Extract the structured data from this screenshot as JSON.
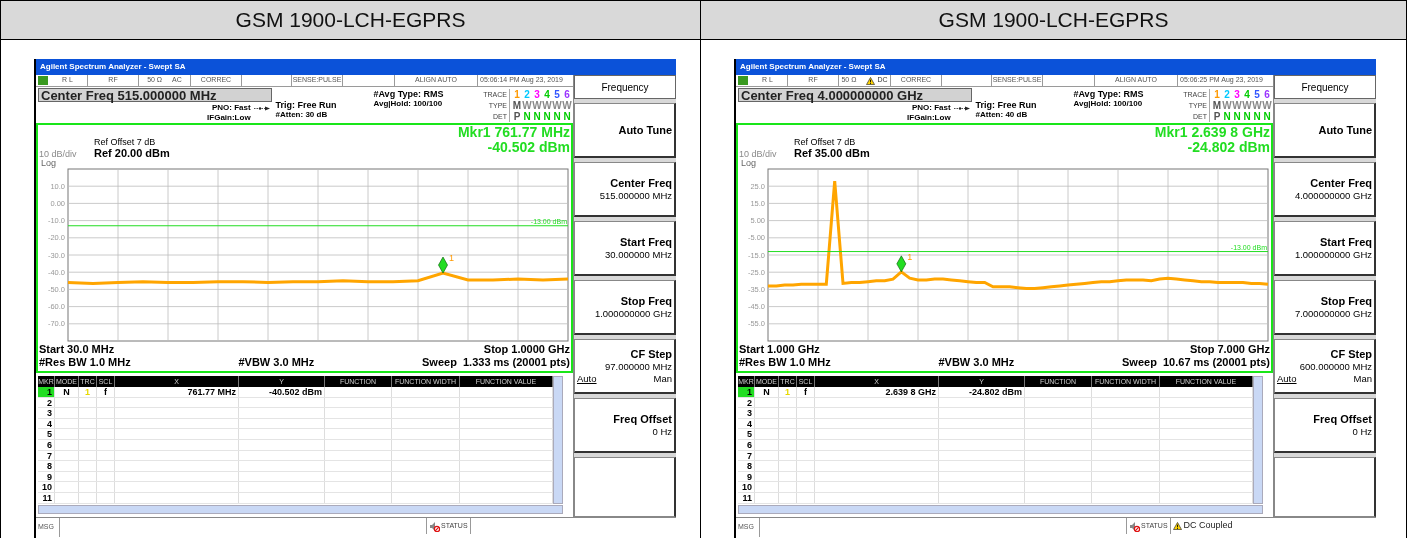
{
  "panels": [
    {
      "heading": "GSM 1900-LCH-EGPRS",
      "window": {
        "title": "Agilent Spectrum Analyzer - Swept SA"
      },
      "status_row": [
        {
          "text": "R L"
        },
        {
          "text": "RF"
        },
        {
          "text": "50 Ω"
        },
        {
          "text": "AC",
          "warning": false
        },
        {
          "text": "CORREC"
        },
        {
          "text": "SENSE:PULSE"
        },
        {
          "text": "ALIGN AUTO"
        },
        {
          "text": "05:06:14 PM Aug 23, 2019"
        }
      ],
      "center_freq": "Center Freq 515.000000 MHz",
      "pno": "PNO: Fast",
      "if_gain": "IFGain:Low",
      "trigger": "Trig: Free Run",
      "atten": "#Atten: 30 dB",
      "avg_type": "#Avg Type: RMS",
      "avg_hold": "Avg|Hold: 100/100",
      "trace_table": [
        {
          "label": "TRACE",
          "values": [
            {
              "text": "1",
              "color": "#ff9900"
            },
            {
              "text": "2",
              "color": "#00c8ff"
            },
            {
              "text": "3",
              "color": "#ff00ff"
            },
            {
              "text": "4",
              "color": "#00cc00"
            },
            {
              "text": "5",
              "color": "#3355ff"
            },
            {
              "text": "6",
              "color": "#9933ff"
            }
          ]
        },
        {
          "label": "TYPE",
          "values": [
            {
              "text": "M",
              "color": "#555555"
            },
            {
              "text": "W",
              "color": "#888888"
            },
            {
              "text": "W",
              "color": "#888888"
            },
            {
              "text": "W",
              "color": "#888888"
            },
            {
              "text": "W",
              "color": "#888888"
            },
            {
              "text": "W",
              "color": "#888888"
            }
          ]
        },
        {
          "label": "DET",
          "values": [
            {
              "text": "P",
              "color": "#555555"
            },
            {
              "text": "N",
              "color": "#00cc00"
            },
            {
              "text": "N",
              "color": "#00cc00"
            },
            {
              "text": "N",
              "color": "#00cc00"
            },
            {
              "text": "N",
              "color": "#00cc00"
            },
            {
              "text": "N",
              "color": "#00cc00"
            }
          ]
        }
      ],
      "scale": "10 dB/div",
      "ref_offset": "Ref Offset 7 dB",
      "ref_level": "Ref 20.00 dBm",
      "marker_freq": "Mkr1 761.77 MHz",
      "marker_level": "-40.502 dBm",
      "log": "Log",
      "chart_data": {
        "type": "line",
        "ylim": [
          -80,
          20
        ],
        "yticks": [
          {
            "value": 10,
            "label": "10.0"
          },
          {
            "value": 0,
            "label": "0.00"
          },
          {
            "value": -10,
            "label": "-10.0"
          },
          {
            "value": -20,
            "label": "-20.0"
          },
          {
            "value": -30,
            "label": "-30.0"
          },
          {
            "value": -40,
            "label": "-40.0"
          },
          {
            "value": -50,
            "label": "-50.0"
          },
          {
            "value": -60,
            "label": "-60.0"
          },
          {
            "value": -70,
            "label": "-70.0"
          }
        ],
        "categories": [
          null,
          null,
          null,
          null,
          null,
          null,
          null,
          null,
          null,
          null,
          null,
          null,
          null,
          null,
          null,
          null,
          null,
          null,
          null,
          null,
          null
        ],
        "series": [
          {
            "color": "#ffa500",
            "values": [
              -46,
              -46.5,
              -46,
              -45.5,
              -46,
              -46,
              -45.5,
              -45.5,
              -46,
              -45.5,
              -45.5,
              -45,
              -45.5,
              -45.5,
              -45,
              -40.5,
              -44.5,
              -44.5,
              -44,
              -44.5,
              -44
            ]
          }
        ],
        "grid": true,
        "ref_lines": [
          {
            "axis": "y",
            "value": -13,
            "label": "-13.00 dBm",
            "color": "#22dd22"
          }
        ],
        "annotations": [
          {
            "text": "1",
            "y": -40.5
          }
        ]
      },
      "start": "Start 30.0 MHz",
      "stop": "Stop 1.0000 GHz",
      "res_bw": "#Res BW 1.0 MHz",
      "vbw": "#VBW 3.0 MHz",
      "sweep": "Sweep  1.333 ms (20001 pts)",
      "marker_table": {
        "columns": [
          "MKR",
          "MODE",
          "TRC",
          "SCL",
          "X",
          "Y",
          "FUNCTION",
          "FUNCTION WIDTH",
          "FUNCTION VALUE"
        ],
        "rows": [
          {
            "mkr": "1",
            "mode": "N",
            "trc": "1",
            "scl": "f",
            "x": "761.77 MHz",
            "y": "-40.502 dBm",
            "selected": true
          },
          {
            "mkr": "2",
            "selected": false
          },
          {
            "mkr": "3",
            "selected": false
          },
          {
            "mkr": "4",
            "selected": false
          },
          {
            "mkr": "5",
            "selected": false
          },
          {
            "mkr": "6",
            "selected": false
          },
          {
            "mkr": "7",
            "selected": false
          },
          {
            "mkr": "8",
            "selected": false
          },
          {
            "mkr": "9",
            "selected": false
          },
          {
            "mkr": "10",
            "selected": false
          },
          {
            "mkr": "11",
            "selected": false
          }
        ]
      },
      "softkeys": {
        "title": "Frequency",
        "keys": [
          {
            "label": "Auto Tune"
          },
          {
            "label": "Center Freq",
            "value": "515.000000 MHz"
          },
          {
            "label": "Start Freq",
            "value": "30.000000 MHz"
          },
          {
            "label": "Stop Freq",
            "value": "1.000000000 GHz"
          },
          {
            "label": "CF Step",
            "value": "97.000000 MHz",
            "options": [
              {
                "text": "Auto",
                "selected": true
              },
              {
                "text": "Man",
                "selected": false
              }
            ]
          },
          {
            "label": "Freq Offset",
            "value": "0 Hz"
          }
        ]
      },
      "msg_bar": {
        "label": "MSG",
        "status": "STATUS"
      }
    },
    {
      "heading": "GSM 1900-LCH-EGPRS",
      "window": {
        "title": "Agilent Spectrum Analyzer - Swept SA"
      },
      "status_row": [
        {
          "text": "R L"
        },
        {
          "text": "RF"
        },
        {
          "text": "50 Ω"
        },
        {
          "text": "DC",
          "warning": true
        },
        {
          "text": "CORREC"
        },
        {
          "text": "SENSE:PULSE"
        },
        {
          "text": "ALIGN AUTO"
        },
        {
          "text": "05:06:25 PM Aug 23, 2019"
        }
      ],
      "center_freq": "Center Freq 4.000000000 GHz",
      "pno": "PNO: Fast",
      "if_gain": "IFGain:Low",
      "trigger": "Trig: Free Run",
      "atten": "#Atten: 40 dB",
      "avg_type": "#Avg Type: RMS",
      "avg_hold": "Avg|Hold: 100/100",
      "trace_table": [
        {
          "label": "TRACE",
          "values": [
            {
              "text": "1",
              "color": "#ff9900"
            },
            {
              "text": "2",
              "color": "#00c8ff"
            },
            {
              "text": "3",
              "color": "#ff00ff"
            },
            {
              "text": "4",
              "color": "#00cc00"
            },
            {
              "text": "5",
              "color": "#3355ff"
            },
            {
              "text": "6",
              "color": "#9933ff"
            }
          ]
        },
        {
          "label": "TYPE",
          "values": [
            {
              "text": "M",
              "color": "#555555"
            },
            {
              "text": "W",
              "color": "#888888"
            },
            {
              "text": "W",
              "color": "#888888"
            },
            {
              "text": "W",
              "color": "#888888"
            },
            {
              "text": "W",
              "color": "#888888"
            },
            {
              "text": "W",
              "color": "#888888"
            }
          ]
        },
        {
          "label": "DET",
          "values": [
            {
              "text": "P",
              "color": "#555555"
            },
            {
              "text": "N",
              "color": "#00cc00"
            },
            {
              "text": "N",
              "color": "#00cc00"
            },
            {
              "text": "N",
              "color": "#00cc00"
            },
            {
              "text": "N",
              "color": "#00cc00"
            },
            {
              "text": "N",
              "color": "#00cc00"
            }
          ]
        }
      ],
      "scale": "10 dB/div",
      "ref_offset": "Ref Offset 7 dB",
      "ref_level": "Ref 35.00 dBm",
      "marker_freq": "Mkr1 2.639 8 GHz",
      "marker_level": "-24.802 dBm",
      "log": "Log",
      "chart_data": {
        "type": "line",
        "ylim": [
          -65,
          35
        ],
        "yticks": [
          {
            "value": 25,
            "label": "25.0"
          },
          {
            "value": 15,
            "label": "15.0"
          },
          {
            "value": 5,
            "label": "5.00"
          },
          {
            "value": -5,
            "label": "-5.00"
          },
          {
            "value": -15,
            "label": "-15.0"
          },
          {
            "value": -25,
            "label": "-25.0"
          },
          {
            "value": -35,
            "label": "-35.0"
          },
          {
            "value": -45,
            "label": "-45.0"
          },
          {
            "value": -55,
            "label": "-55.0"
          }
        ],
        "categories": [
          null,
          null,
          null,
          null,
          null,
          null,
          null,
          null,
          null,
          null,
          null,
          null,
          null,
          null,
          null,
          null,
          null,
          null,
          null,
          null,
          null,
          null,
          null,
          null,
          null,
          null,
          null,
          null,
          null,
          null,
          null,
          null,
          null,
          null,
          null,
          null,
          null,
          null,
          null,
          null,
          null,
          null,
          null,
          null,
          null,
          null,
          null,
          null,
          null,
          null,
          null,
          null,
          null,
          null,
          null,
          null,
          null,
          null,
          null,
          null,
          null
        ],
        "series": [
          {
            "color": "#ffa500",
            "values": [
              -33,
              -33,
              -32.5,
              -32.5,
              -32,
              -32,
              -32,
              -32,
              28,
              -31.5,
              -31,
              -31,
              -30.5,
              -30,
              -30,
              -29,
              -24.8,
              -28.5,
              -29.5,
              -29.5,
              -29,
              -29,
              -29.5,
              -30,
              -30.5,
              -31,
              -31,
              -33.5,
              -33.5,
              -33.5,
              -34,
              -34.5,
              -34.5,
              -34,
              -33.5,
              -33,
              -32.5,
              -32,
              -31.5,
              -31,
              -30.5,
              -30.5,
              -30,
              -29.5,
              -29.5,
              -29.5,
              -30,
              -29,
              -28.5,
              -29,
              -29.5,
              -30,
              -30.5,
              -30.5,
              -31,
              -31,
              -31,
              -31,
              -31.5,
              -31.5,
              -32
            ]
          }
        ],
        "grid": true,
        "ref_lines": [
          {
            "axis": "y",
            "value": -13,
            "label": "-13.00 dBm",
            "color": "#22dd22"
          }
        ],
        "annotations": [
          {
            "text": "1",
            "y": -24.8
          }
        ]
      },
      "start": "Start 1.000 GHz",
      "stop": "Stop 7.000 GHz",
      "res_bw": "#Res BW 1.0 MHz",
      "vbw": "#VBW 3.0 MHz",
      "sweep": "Sweep  10.67 ms (20001 pts)",
      "marker_table": {
        "columns": [
          "MKR",
          "MODE",
          "TRC",
          "SCL",
          "X",
          "Y",
          "FUNCTION",
          "FUNCTION WIDTH",
          "FUNCTION VALUE"
        ],
        "rows": [
          {
            "mkr": "1",
            "mode": "N",
            "trc": "1",
            "scl": "f",
            "x": "2.639 8 GHz",
            "y": "-24.802 dBm",
            "selected": true
          },
          {
            "mkr": "2",
            "selected": false
          },
          {
            "mkr": "3",
            "selected": false
          },
          {
            "mkr": "4",
            "selected": false
          },
          {
            "mkr": "5",
            "selected": false
          },
          {
            "mkr": "6",
            "selected": false
          },
          {
            "mkr": "7",
            "selected": false
          },
          {
            "mkr": "8",
            "selected": false
          },
          {
            "mkr": "9",
            "selected": false
          },
          {
            "mkr": "10",
            "selected": false
          },
          {
            "mkr": "11",
            "selected": false
          }
        ]
      },
      "softkeys": {
        "title": "Frequency",
        "keys": [
          {
            "label": "Auto Tune"
          },
          {
            "label": "Center Freq",
            "value": "4.000000000 GHz"
          },
          {
            "label": "Start Freq",
            "value": "1.000000000 GHz"
          },
          {
            "label": "Stop Freq",
            "value": "7.000000000 GHz"
          },
          {
            "label": "CF Step",
            "value": "600.000000 MHz",
            "options": [
              {
                "text": "Auto",
                "selected": true
              },
              {
                "text": "Man",
                "selected": false
              }
            ]
          },
          {
            "label": "Freq Offset",
            "value": "0 Hz"
          }
        ]
      },
      "msg_bar": {
        "label": "MSG",
        "status": "STATUS",
        "alerts": [
          {
            "text": "DC Coupled"
          }
        ]
      }
    }
  ]
}
